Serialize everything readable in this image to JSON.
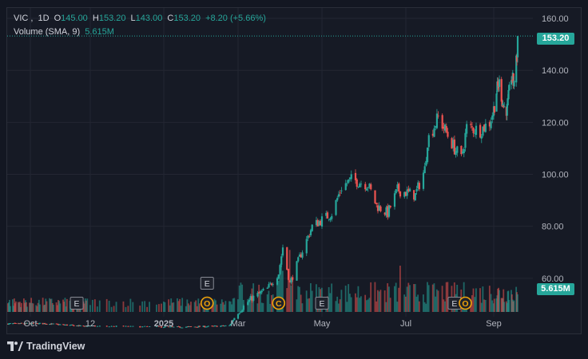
{
  "legend": {
    "symbol": "VIC",
    "interval": "1D",
    "open_key": "O",
    "open": "145.00",
    "high_key": "H",
    "high": "153.20",
    "low_key": "L",
    "low": "143.00",
    "close_key": "C",
    "close": "153.20",
    "change": "+8.20 (+5.66%)",
    "volume_label": "Volume (SMA, 9)",
    "volume_value": "5.615M"
  },
  "price_tag": "153.20",
  "volume_tag": "5.615M",
  "brand": "TradingView",
  "colors": {
    "up": "#26a69a",
    "down": "#ef5350",
    "bg": "#161a25",
    "grid": "#232632",
    "text": "#d1d4dc",
    "axis": "#b2b5be",
    "marker": "#f0a30a"
  },
  "chart_data": {
    "type": "candlestick",
    "y_ticks": [
      "160.00",
      "140.00",
      "120.00",
      "100.00",
      "80.00",
      "60.00"
    ],
    "ylim": [
      40,
      164
    ],
    "x_ticks": [
      {
        "label": "Oct",
        "date": "2024-10-01",
        "bold": false
      },
      {
        "label": "12",
        "date": "2024-12-02",
        "bold": false
      },
      {
        "label": "2025",
        "date": "2025-01-02",
        "bold": true
      },
      {
        "label": "Mar",
        "date": "2025-03-03",
        "bold": false
      },
      {
        "label": "May",
        "date": "2025-05-02",
        "bold": false
      },
      {
        "label": "Jul",
        "date": "2025-07-01",
        "bold": false
      },
      {
        "label": "Sep",
        "date": "2025-09-04",
        "bold": false
      }
    ],
    "price_path": [
      [
        "2024-09-03",
        42.5
      ],
      [
        "2024-10-15",
        42.6
      ],
      [
        "2024-11-20",
        41.7
      ],
      [
        "2025-01-10",
        41.2
      ],
      [
        "2025-02-10",
        41.5
      ],
      [
        "2025-02-24",
        41.8
      ],
      [
        "2025-03-03",
        47
      ],
      [
        "2025-03-12",
        52
      ],
      [
        "2025-03-24",
        56
      ],
      [
        "2025-04-01",
        62
      ],
      [
        "2025-04-04",
        72
      ],
      [
        "2025-04-09",
        58
      ],
      [
        "2025-04-16",
        68
      ],
      [
        "2025-04-25",
        80
      ],
      [
        "2025-05-09",
        85
      ],
      [
        "2025-05-16",
        95
      ],
      [
        "2025-05-23",
        98
      ],
      [
        "2025-06-04",
        96
      ],
      [
        "2025-06-10",
        88
      ],
      [
        "2025-06-18",
        85
      ],
      [
        "2025-06-25",
        94
      ],
      [
        "2025-07-08",
        92
      ],
      [
        "2025-07-15",
        102
      ],
      [
        "2025-07-17",
        113
      ],
      [
        "2025-07-25",
        122
      ],
      [
        "2025-08-01",
        115
      ],
      [
        "2025-08-06",
        110
      ],
      [
        "2025-08-11",
        106
      ],
      [
        "2025-08-15",
        118
      ],
      [
        "2025-08-25",
        117
      ],
      [
        "2025-09-01",
        120
      ],
      [
        "2025-09-08",
        132
      ],
      [
        "2025-09-12",
        135
      ],
      [
        "2025-09-18",
        126
      ],
      [
        "2025-09-23",
        125
      ],
      [
        "2025-09-29",
        138
      ],
      [
        "2025-10-02",
        135
      ],
      [
        "2025-10-07",
        145
      ],
      [
        "2025-10-08",
        153.2
      ]
    ],
    "last_close": 153.2,
    "volume_sma_last": "5.615M",
    "event_markers": [
      {
        "label": "E",
        "kind": "earnings",
        "date": "2024-11-18",
        "row": "bottom"
      },
      {
        "label": "E",
        "kind": "earnings",
        "date": "2025-02-06",
        "row": "top"
      },
      {
        "label": "O",
        "kind": "other",
        "date": "2025-02-06",
        "row": "bottom"
      },
      {
        "label": "C",
        "kind": "other",
        "date": "2025-04-01",
        "row": "bottom"
      },
      {
        "label": "E",
        "kind": "earnings",
        "date": "2025-05-02",
        "row": "bottom"
      },
      {
        "label": "E",
        "kind": "earnings",
        "date": "2025-08-06",
        "row": "bottom"
      },
      {
        "label": "O",
        "kind": "other",
        "date": "2025-08-14",
        "row": "bottom"
      }
    ]
  }
}
